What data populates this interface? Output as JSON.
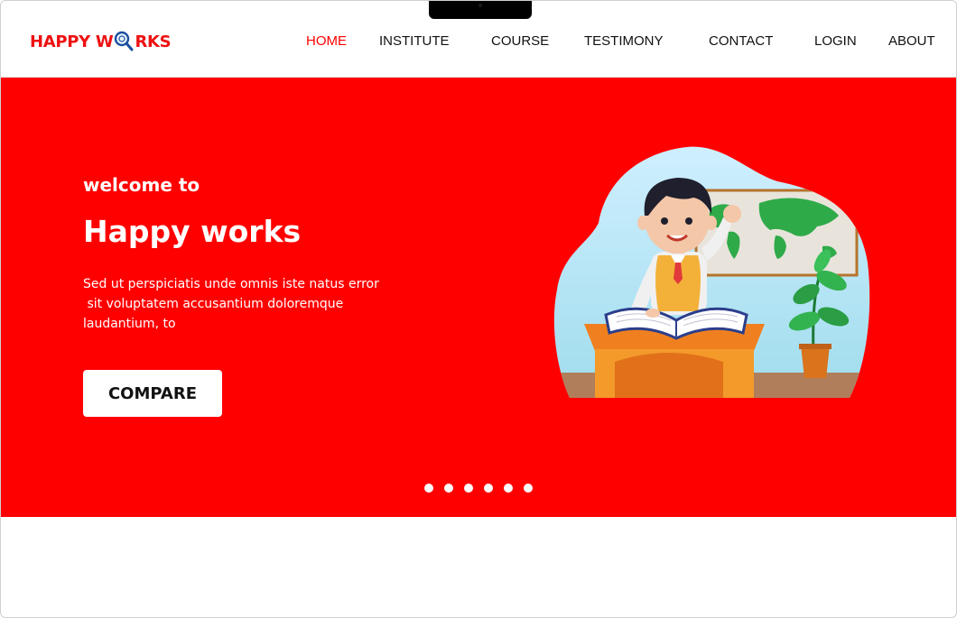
{
  "brand": {
    "name": "HAPPY WORKS",
    "part1": "HAPPY W",
    "part2": "RKS"
  },
  "nav": {
    "items": [
      {
        "label": "HOME",
        "active": true
      },
      {
        "label": "INSTITUTE"
      },
      {
        "label": "COURSE"
      },
      {
        "label": "TESTIMONY"
      },
      {
        "label": "CONTACT"
      },
      {
        "label": "LOGIN"
      },
      {
        "label": "ABOUT"
      }
    ]
  },
  "hero": {
    "welcome": "welcome to",
    "title": "Happy works",
    "text_lines": [
      "Sed ut perspiciatis unde omnis iste natus error",
      " sit voluptatem accusantium doloremque",
      "laudantium, to"
    ],
    "button_label": "COMPARE",
    "background_color": "#ff0000",
    "illustration": "boy-reading-book-at-desk-with-world-map"
  },
  "carousel": {
    "slide_count": 6
  },
  "colors": {
    "accent": "#ff0000",
    "text": "#111111",
    "white": "#ffffff"
  }
}
